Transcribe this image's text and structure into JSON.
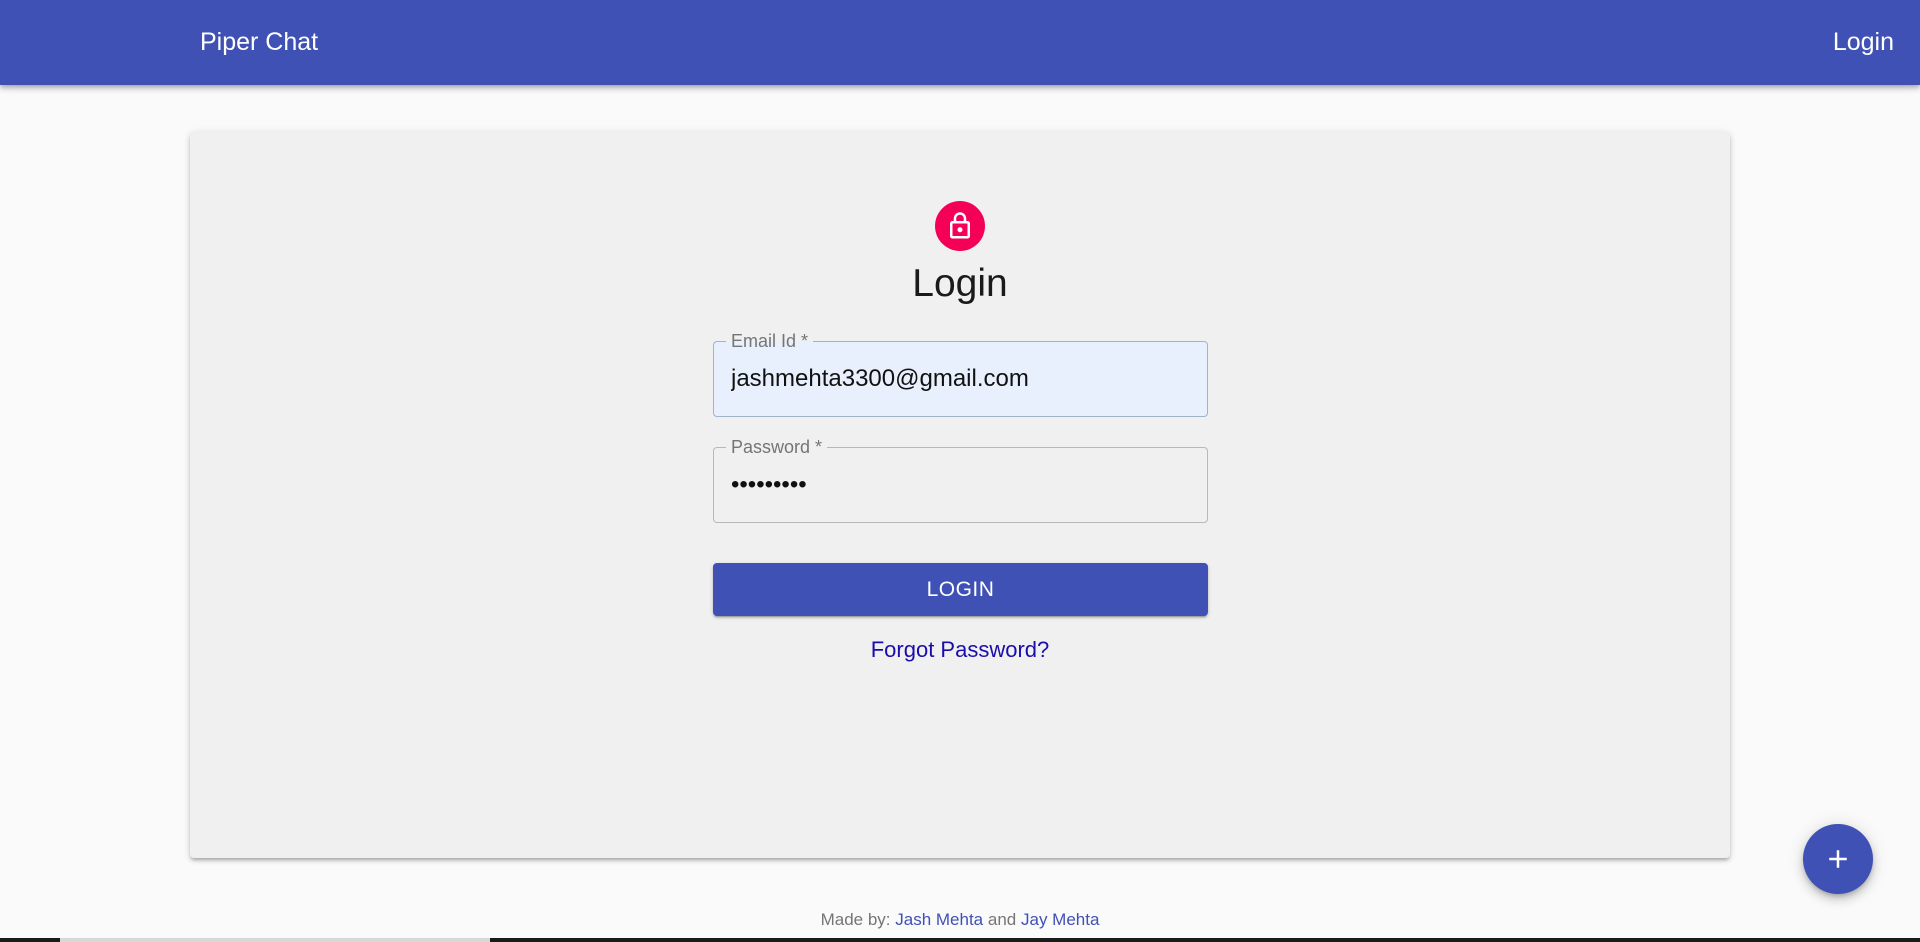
{
  "appbar": {
    "brand": "Piper Chat",
    "nav_login": "Login",
    "color": "#3f51b5"
  },
  "login_card": {
    "lock_icon": "lock-icon",
    "lock_color": "#f50057",
    "title": "Login",
    "email": {
      "label": "Email Id *",
      "value": "jashmehta3300@gmail.com"
    },
    "password": {
      "label": "Password *",
      "masked_value": "•••••••••"
    },
    "submit_label": "LOGIN",
    "forgot_label": "Forgot Password?"
  },
  "fab": {
    "icon": "plus-icon"
  },
  "footer": {
    "prefix": "Made by:",
    "author1": "Jash Mehta",
    "conjunction": "and",
    "author2": "Jay Mehta"
  }
}
